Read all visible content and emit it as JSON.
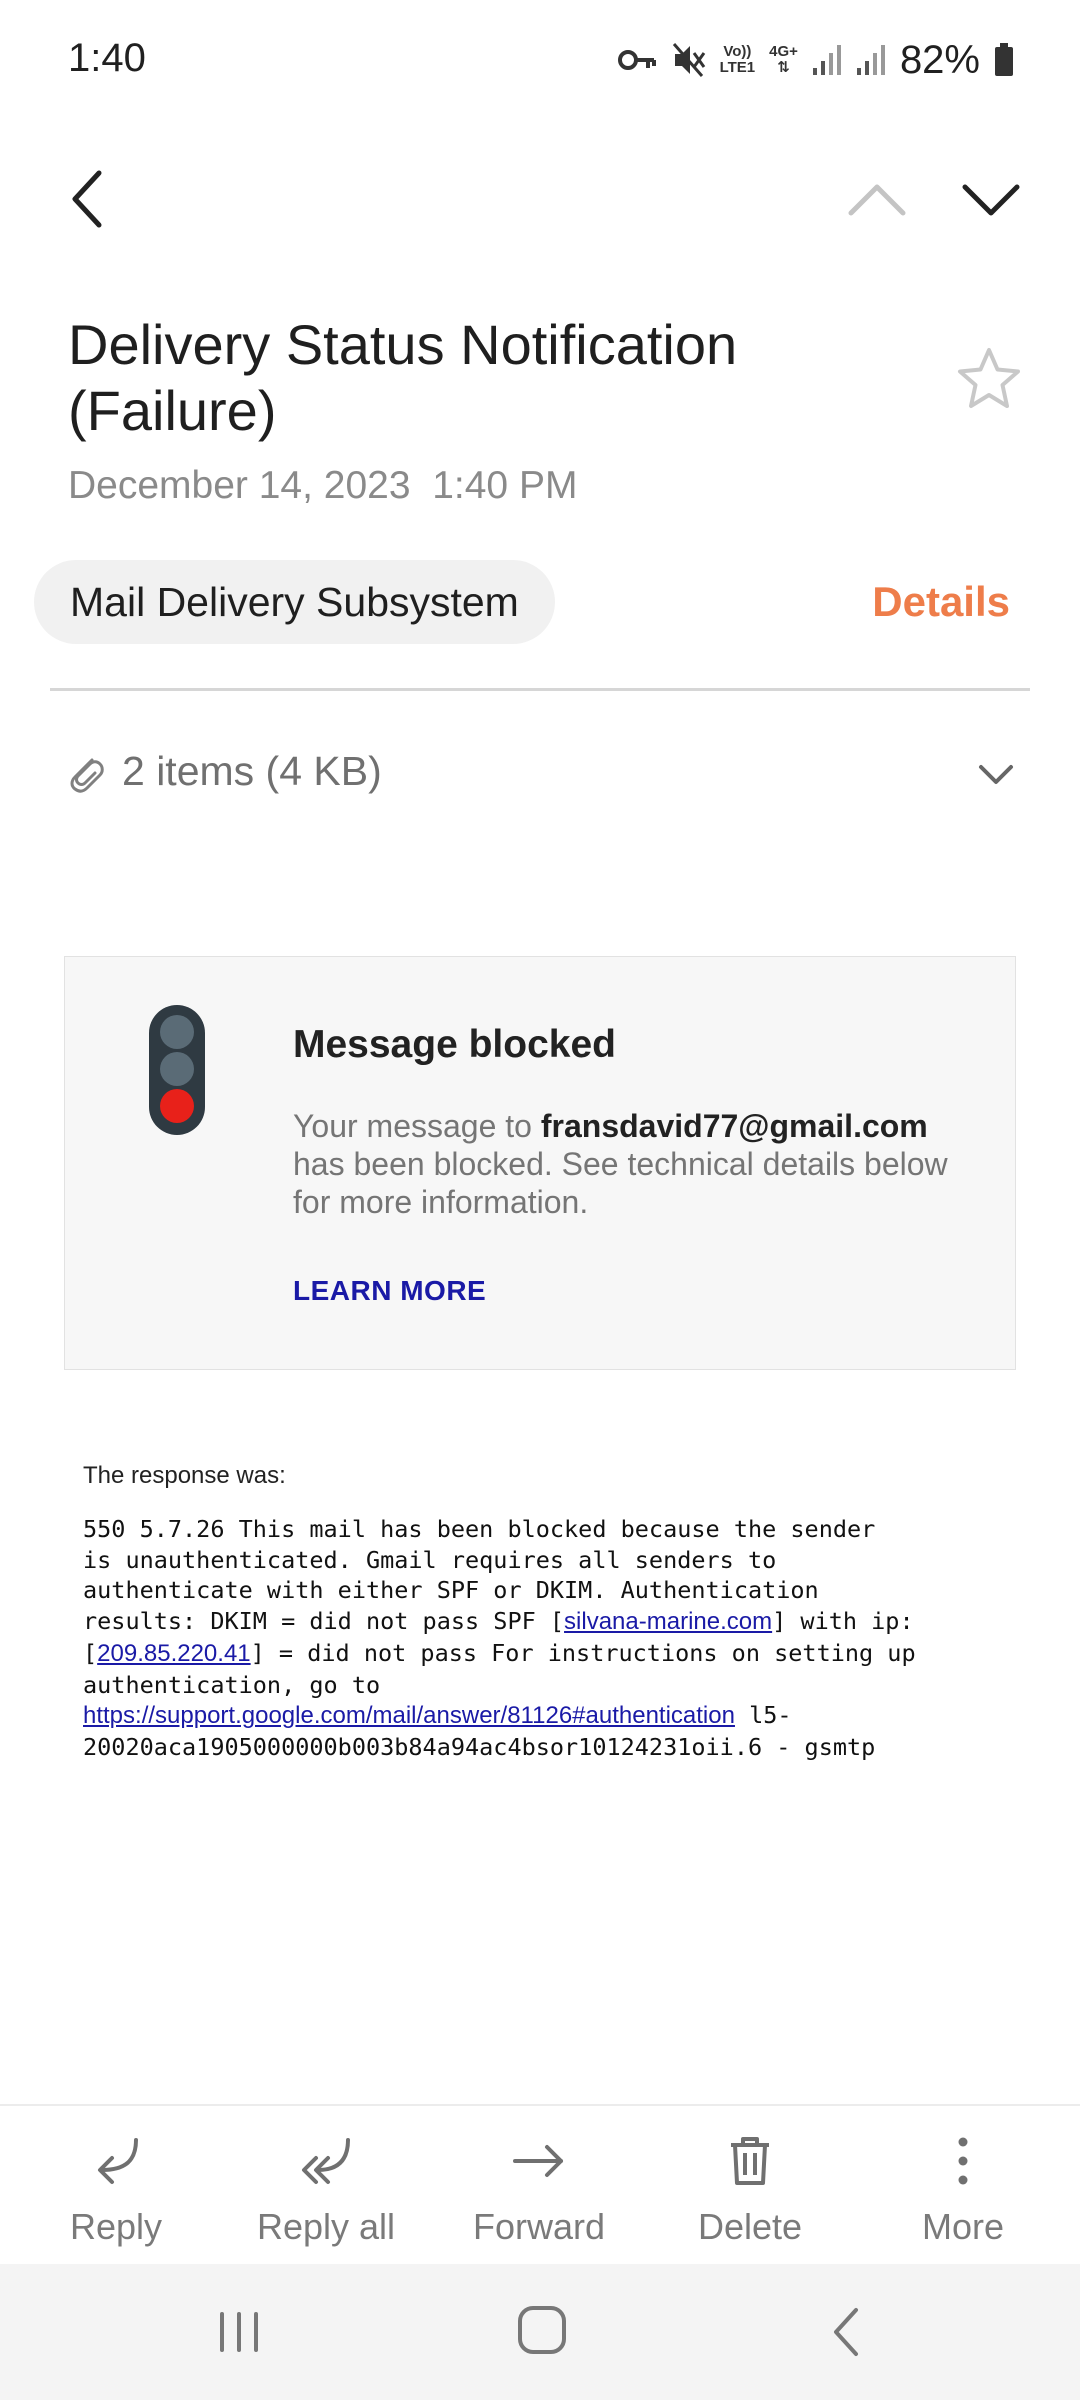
{
  "status_bar": {
    "time": "1:40",
    "lte_top": "Vo))",
    "lte_bottom": "LTE1",
    "net_type": "4G+",
    "battery": "82%"
  },
  "nav": {
    "back_icon": "chevron-left-icon",
    "prev_icon": "chevron-up-icon",
    "next_icon": "chevron-down-icon"
  },
  "email": {
    "subject_line1": "Delivery Status Notification",
    "subject_line2": "(Failure)",
    "date": "December 14, 2023",
    "time": "1:40 PM",
    "sender": "Mail Delivery Subsystem",
    "details_label": "Details",
    "attachments": "2 items (4 KB)"
  },
  "card": {
    "title": "Message blocked",
    "body_prefix": "Your message to ",
    "recipient": "fransdavid77@gmail.com",
    "body_suffix": " has been blocked. See technical details below for more information.",
    "learn_more": "LEARN MORE"
  },
  "response": {
    "label": "The response was:",
    "line1": "550 5.7.26 This mail has been blocked because the sender",
    "line2": "is unauthenticated. Gmail requires all senders to",
    "line3": "authenticate with either SPF or DKIM. Authentication",
    "line4_prefix": "results: DKIM = did not pass SPF [",
    "line4_link": "silvana-marine.com",
    "line4_suffix": "] with ip:",
    "line5_prefix": "[",
    "line5_link": "209.85.220.41",
    "line5_suffix": "] = did not pass For instructions on setting up",
    "line6": "authentication, go to",
    "line7_link": "https://support.google.com/mail/answer/81126#authentication",
    "line7_suffix": " l5-",
    "line8": "20020aca1905000000b003b84a94ac4bsor10124231oii.6 - gsmtp"
  },
  "actions": [
    {
      "label": "Reply",
      "icon": "reply-icon"
    },
    {
      "label": "Reply all",
      "icon": "reply-all-icon"
    },
    {
      "label": "Forward",
      "icon": "forward-icon"
    },
    {
      "label": "Delete",
      "icon": "trash-icon"
    },
    {
      "label": "More",
      "icon": "more-vertical-icon"
    }
  ],
  "colors": {
    "accent": "#ee7d4a",
    "link": "#1a1aa6",
    "traffic_light_red": "#e8211a"
  }
}
